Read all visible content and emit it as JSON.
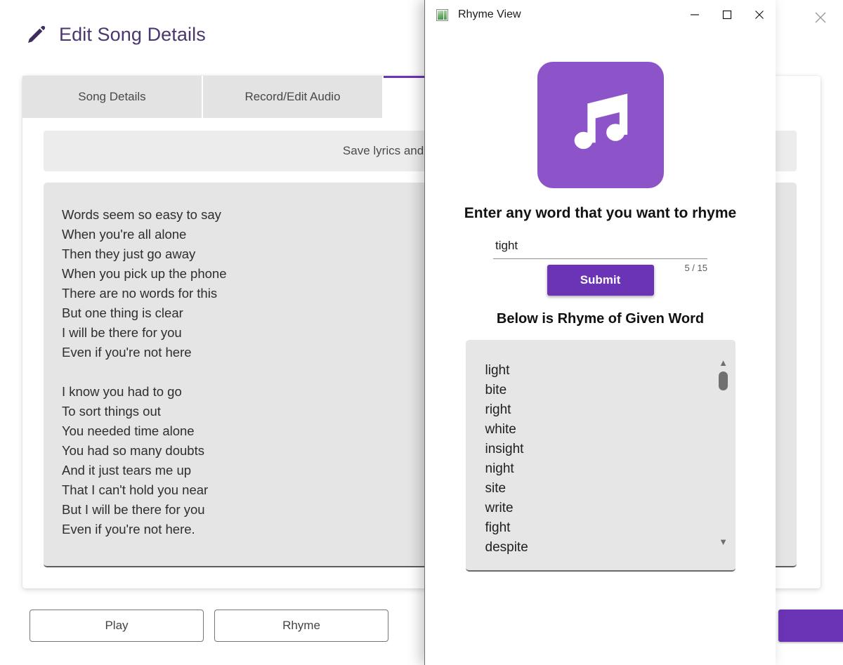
{
  "app": {
    "title": "Edit Song Details",
    "close_label": "✕",
    "tabs": [
      {
        "label": "Song Details",
        "active": false
      },
      {
        "label": "Record/Edit Audio",
        "active": false
      },
      {
        "label": "",
        "active": true
      }
    ],
    "save_bar_text": "Save lyrics and continue to w",
    "lyrics": "Words seem so easy to say\nWhen you're all alone\nThen they just go away\nWhen you pick up the phone\nThere are no words for this\nBut one thing is clear\nI will be there for you\nEven if you're not here\n\nI know you had to go\nTo sort things out\nYou needed time alone\nYou had so many doubts\nAnd it just tears me up\nThat I can't hold you near\nBut I will be there for you\nEven if you're not here.",
    "buttons": {
      "play": "Play",
      "rhyme": "Rhyme",
      "primary": ""
    }
  },
  "modal": {
    "title": "Rhyme View",
    "minimize_label": "—",
    "maximize_label": "☐",
    "close_label": "✕",
    "heading": "Enter any word that you want to rhyme",
    "input": {
      "value": "tight",
      "placeholder": "",
      "counter": "5 / 15"
    },
    "submit_label": "Submit",
    "result_heading": "Below is Rhyme of Given Word",
    "results": [
      "light",
      "bite",
      "right",
      "white",
      "insight",
      "night",
      "site",
      "write",
      "fight",
      "despite"
    ],
    "scroll_up": "▲",
    "scroll_down": "▼"
  },
  "colors": {
    "accent_purple": "#6b33b5",
    "album_purple": "#8c54c8",
    "title_purple": "#4a3670"
  }
}
